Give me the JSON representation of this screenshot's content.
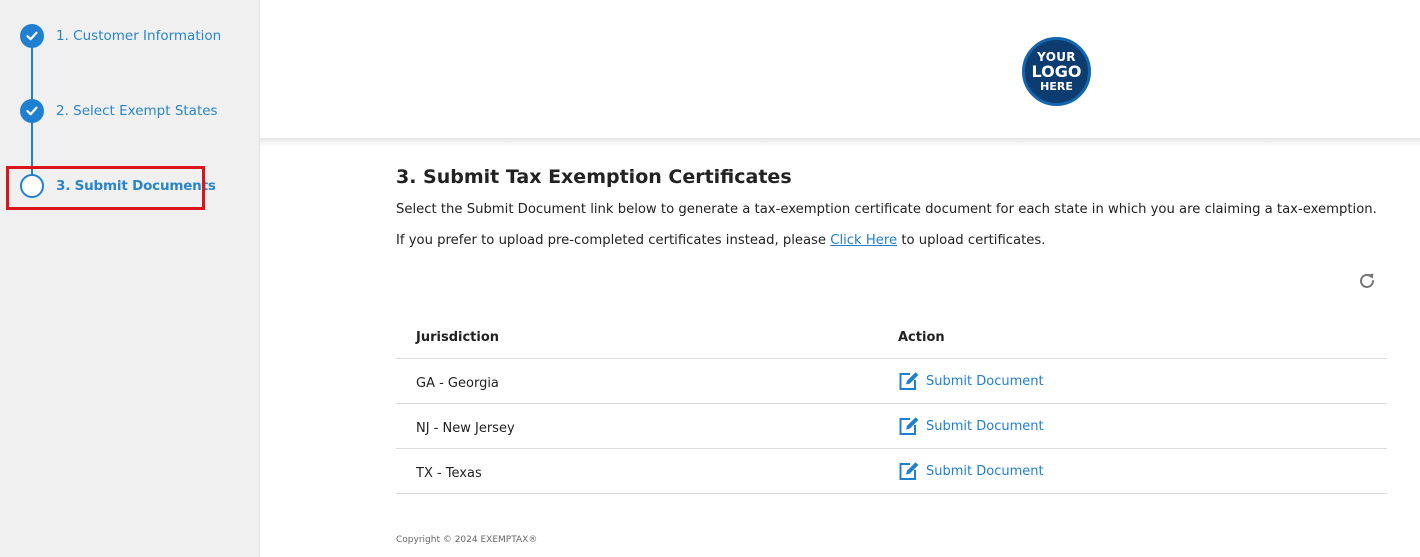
{
  "sidebar": {
    "steps": [
      {
        "label": "1. Customer Information",
        "state": "complete"
      },
      {
        "label": "2. Select Exempt States",
        "state": "complete"
      },
      {
        "label": "3. Submit Documents",
        "state": "current"
      }
    ]
  },
  "header": {
    "logo": {
      "line1": "YOUR",
      "line2": "LOGO",
      "line3": "HERE"
    }
  },
  "main": {
    "title": "3. Submit Tax Exemption Certificates",
    "description": "Select the Submit Document link below to generate a tax-exemption certificate document for each state in which you are claiming a tax-exemption.",
    "upload_prefix": "If you prefer to upload pre-completed certificates instead, please ",
    "upload_link": "Click Here",
    "upload_suffix": " to upload certificates.",
    "refresh_icon": "refresh-icon",
    "table": {
      "headers": [
        "Jurisdiction",
        "Action"
      ],
      "rows": [
        {
          "jurisdiction": "GA - Georgia",
          "action": "Submit Document"
        },
        {
          "jurisdiction": "NJ - New Jersey",
          "action": "Submit Document"
        },
        {
          "jurisdiction": "TX - Texas",
          "action": "Submit Document"
        }
      ]
    }
  },
  "footer": {
    "copyright": "Copyright © 2024 EXEMPTAX®"
  },
  "colors": {
    "accent": "#1f7fd0",
    "highlight": "#d9141b",
    "sidebar_bg": "#f0f0f0",
    "logo_bg": "#0d3d70"
  }
}
